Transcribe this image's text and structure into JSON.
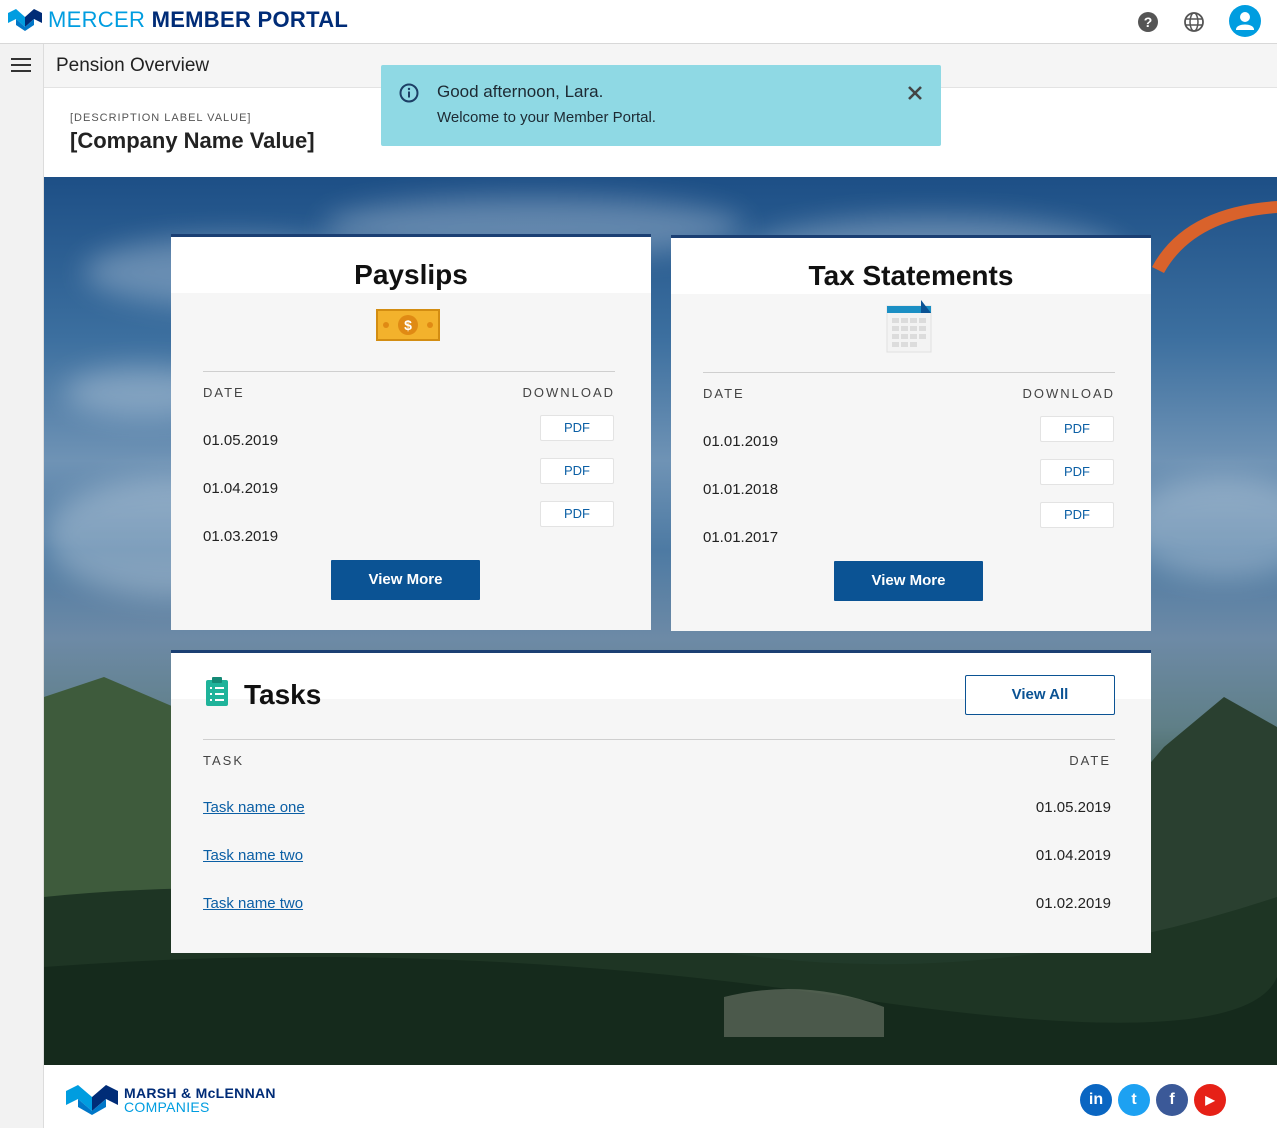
{
  "header": {
    "brand_light": "MERCER",
    "brand_bold": "MEMBER PORTAL",
    "help_icon": "question-circle-icon",
    "globe_icon": "globe-icon",
    "avatar_icon": "user-avatar-icon"
  },
  "subheader": {
    "menu_icon": "hamburger-menu-icon",
    "title": "Pension Overview"
  },
  "company": {
    "label": "[DESCRIPTION LABEL VALUE]",
    "name": "[Company Name Value]"
  },
  "toast": {
    "icon": "info-icon",
    "line1": "Good afternoon, Lara.",
    "line2": "Welcome to your Member Portal.",
    "close_icon": "close-icon"
  },
  "payslips": {
    "title": "Payslips",
    "icon": "money-bill-icon",
    "col_date": "DATE",
    "col_download": "DOWNLOAD",
    "rows": [
      {
        "date": "01.05.2019",
        "download": "PDF"
      },
      {
        "date": "01.04.2019",
        "download": "PDF"
      },
      {
        "date": "01.03.2019",
        "download": "PDF"
      }
    ],
    "button": "View More"
  },
  "tax": {
    "title": "Tax Statements",
    "icon": "calendar-icon",
    "col_date": "DATE",
    "col_download": "DOWNLOAD",
    "rows": [
      {
        "date": "01.01.2019",
        "download": "PDF"
      },
      {
        "date": "01.01.2018",
        "download": "PDF"
      },
      {
        "date": "01.01.2017",
        "download": "PDF"
      }
    ],
    "button": "View More"
  },
  "tasks": {
    "title": "Tasks",
    "icon": "clipboard-list-icon",
    "button": "View All",
    "col_task": "TASK",
    "col_date": "DATE",
    "rows": [
      {
        "name": "Task name one",
        "date": "01.05.2019"
      },
      {
        "name": "Task name two",
        "date": "01.04.2019"
      },
      {
        "name": "Task name two",
        "date": "01.02.2019"
      }
    ]
  },
  "footer": {
    "company_line1": "MARSH & McLENNAN",
    "company_line2": "COMPANIES",
    "social": [
      {
        "icon": "linkedin-icon",
        "label": "in",
        "color": "#0a66c2"
      },
      {
        "icon": "twitter-icon",
        "label": "t",
        "color": "#1da1f2"
      },
      {
        "icon": "facebook-icon",
        "label": "f",
        "color": "#3b5998"
      },
      {
        "icon": "youtube-icon",
        "label": "▶",
        "color": "#e62117"
      }
    ]
  },
  "colors": {
    "brand_blue": "#002c77",
    "brand_cyan": "#009de0",
    "primary_button": "#0b5394",
    "toast_bg": "#8fd9e4"
  }
}
